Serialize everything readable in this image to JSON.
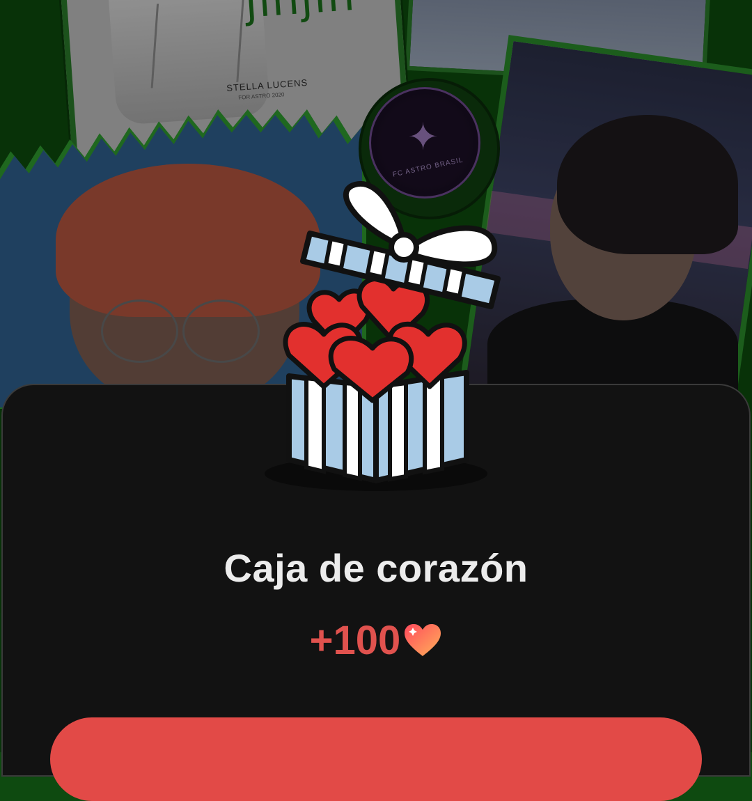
{
  "background": {
    "card_word": "jinjin",
    "card_brand": "STELLA LUCENS",
    "card_brand_sub": "FOR ASTRO 2020",
    "logo_text": "FC ASTRO BRASIL"
  },
  "reward_popup": {
    "icon": "heart-gift-box-icon",
    "title": "Caja de corazón",
    "amount": "+100",
    "currency_icon": "heart-icon",
    "accent_color": "#e24a47"
  }
}
